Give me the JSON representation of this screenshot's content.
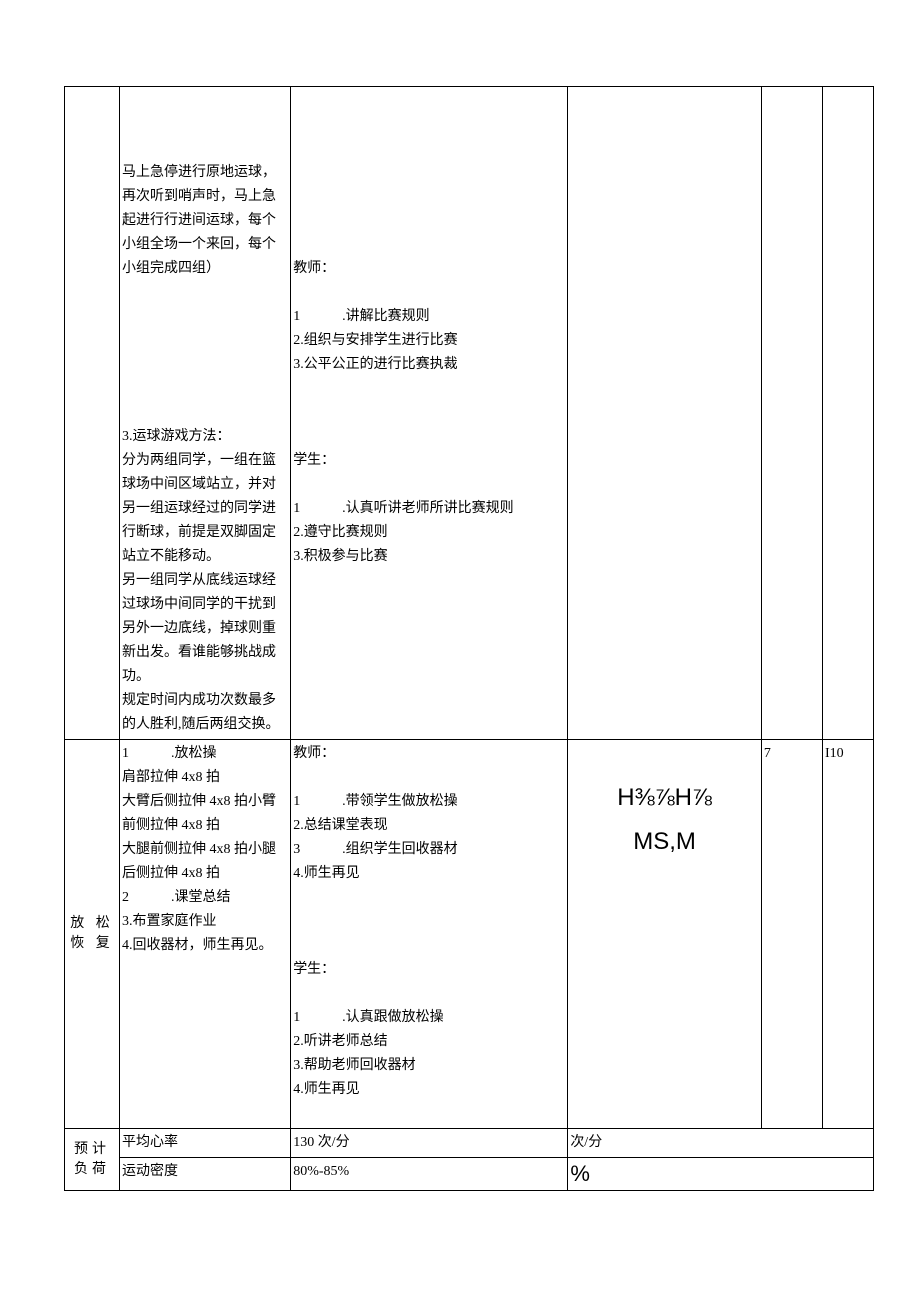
{
  "row1": {
    "col2": {
      "block1": "马上急停进行原地运球，再次听到哨声时，马上急起进行行进间运球，每个小组全场一个来回，每个小组完成四组）",
      "block2_title": "3.运球游戏方法：",
      "block2_body": "分为两组同学，一组在篮球场中间区域站立，并对另一组运球经过的同学进行断球，前提是双脚固定站立不能移动。\n另一组同学从底线运球经过球场中间同学的干扰到另外一边底线，掉球则重新出发。看谁能够挑战成功。\n规定时间内成功次数最多的人胜利,随后两组交换。"
    },
    "col3": {
      "teacher_label": "教师：",
      "teacher_items": [
        "1　　　.讲解比赛规则",
        "2.组织与安排学生进行比赛",
        "3.公平公正的进行比赛执裁"
      ],
      "student_label": "学生：",
      "student_items": [
        "1　　　.认真听讲老师所讲比赛规则",
        "2.遵守比赛规则",
        "3.积极参与比赛"
      ]
    }
  },
  "row2": {
    "label": "放 松\n恢 复",
    "col2": {
      "line1": "1　　　.放松操",
      "lines": [
        "肩部拉伸 4x8 拍",
        "大臂后侧拉伸 4x8 拍小臂前侧拉伸 4x8 拍",
        "大腿前侧拉伸 4x8 拍小腿后侧拉伸 4x8 拍",
        "2　　　.课堂总结",
        "3.布置家庭作业",
        "4.回收器材，师生再见。"
      ]
    },
    "col3": {
      "teacher_label": "教师：",
      "teacher_items": [
        "1　　　.带领学生做放松操",
        "2.总结课堂表现",
        "3　　　.组织学生回收器材",
        "4.师生再见"
      ],
      "student_label": "学生：",
      "student_items": [
        "1　　　.认真跟做放松操",
        "2.听讲老师总结",
        "3.帮助老师回收器材",
        "4.师生再见"
      ]
    },
    "col4": "H⅜⅞H⅞\nMS,M",
    "col5": "7",
    "col6": "I10"
  },
  "row3": {
    "label": "预计负荷",
    "r1c1": "平均心率",
    "r1c2": "130 次/分",
    "r1c3": "次/分",
    "r2c1": "运动密度",
    "r2c2": "80%-85%",
    "r2c3": "%"
  }
}
